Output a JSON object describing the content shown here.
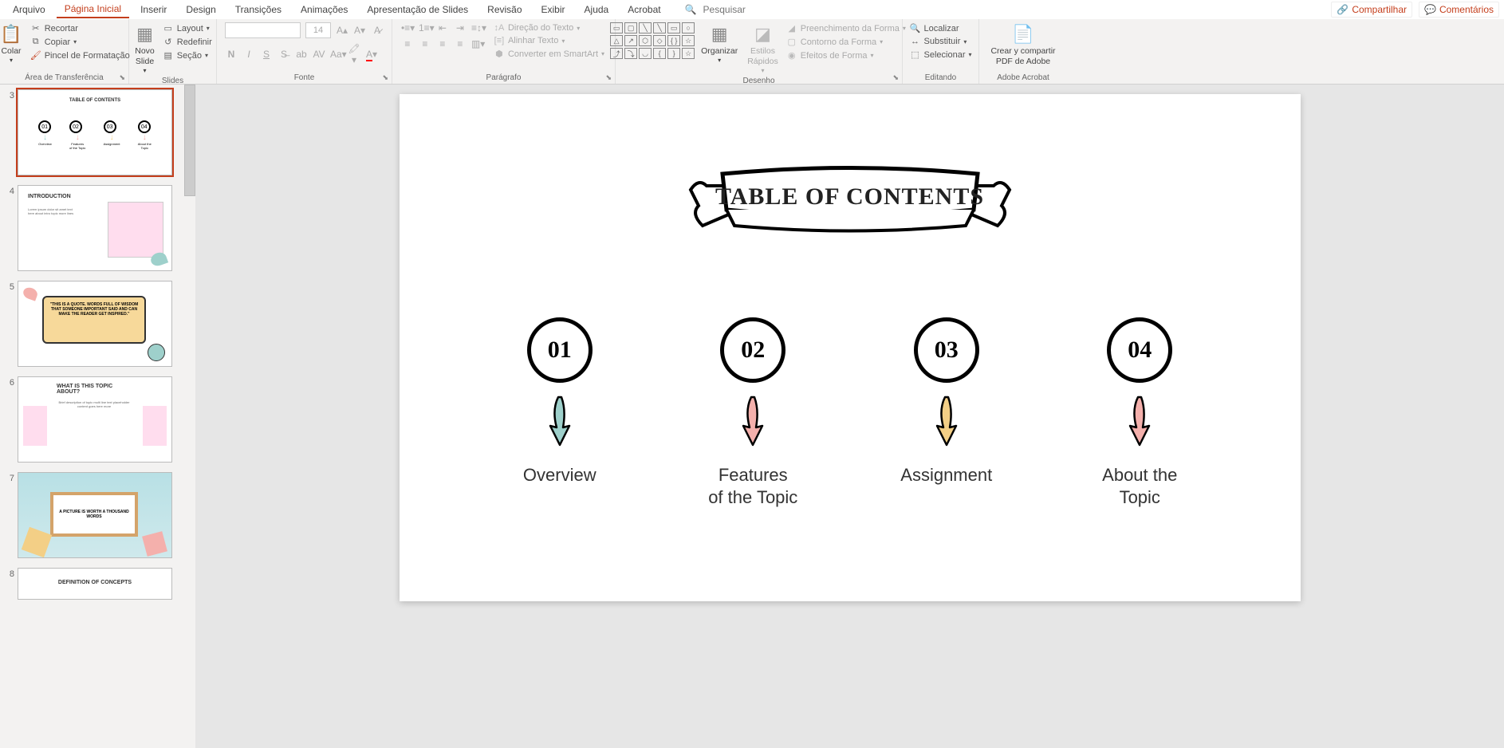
{
  "menu": {
    "tabs": [
      "Arquivo",
      "Página Inicial",
      "Inserir",
      "Design",
      "Transições",
      "Animações",
      "Apresentação de Slides",
      "Revisão",
      "Exibir",
      "Ajuda",
      "Acrobat"
    ],
    "active_index": 1,
    "search_placeholder": "Pesquisar",
    "share": "Compartilhar",
    "comments": "Comentários"
  },
  "ribbon": {
    "clipboard": {
      "paste": "Colar",
      "cut": "Recortar",
      "copy": "Copiar",
      "format_painter": "Pincel de Formatação",
      "label": "Área de Transferência"
    },
    "slides": {
      "new_slide": "Novo\nSlide",
      "layout": "Layout",
      "reset": "Redefinir",
      "section": "Seção",
      "label": "Slides"
    },
    "font": {
      "size": "14",
      "label": "Fonte"
    },
    "paragraph": {
      "direction": "Direção do Texto",
      "align": "Alinhar Texto",
      "smartart": "Converter em SmartArt",
      "label": "Parágrafo"
    },
    "drawing": {
      "arrange": "Organizar",
      "quick_styles": "Estilos\nRápidos",
      "fill": "Preenchimento da Forma",
      "outline": "Contorno da Forma",
      "effects": "Efeitos de Forma",
      "label": "Desenho"
    },
    "editing": {
      "find": "Localizar",
      "replace": "Substituir",
      "select": "Selecionar",
      "label": "Editando"
    },
    "adobe": {
      "create_share": "Crear y compartir\nPDF de Adobe",
      "label": "Adobe Acrobat"
    }
  },
  "thumbs": {
    "start_index": 3,
    "slide4_title": "INTRODUCTION",
    "slide5_quote": "\"THIS IS A QUOTE. WORDS FULL OF WISDOM THAT SOMEONE IMPORTANT SAID AND CAN MAKE THE READER GET INSPIRED.\"",
    "slide6_title": "WHAT IS THIS TOPIC ABOUT?",
    "slide7_title": "A PICTURE IS WORTH A THOUSAND WORDS",
    "slide8_title": "DEFINITION OF CONCEPTS"
  },
  "slide": {
    "title": "TABLE OF CONTENTS",
    "items": [
      {
        "num": "01",
        "label": "Overview",
        "arrow_color": "#9ed0cb"
      },
      {
        "num": "02",
        "label": "Features\nof the Topic",
        "arrow_color": "#f4b0ac"
      },
      {
        "num": "03",
        "label": "Assignment",
        "arrow_color": "#f3cf86"
      },
      {
        "num": "04",
        "label": "About the\nTopic",
        "arrow_color": "#f4b0ac"
      }
    ]
  }
}
